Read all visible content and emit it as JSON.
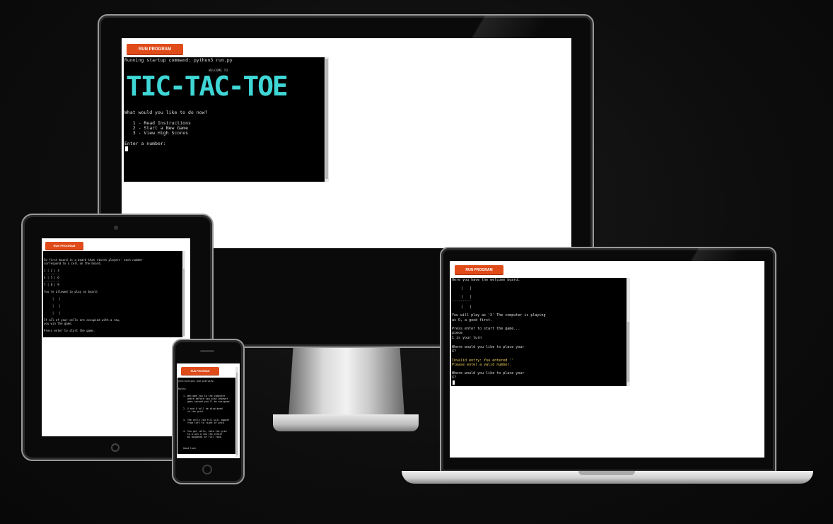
{
  "run_label": "RUN PROGRAM",
  "desktop": {
    "lines": [
      "Running startup command: python3 run.py",
      "What would you like to do now?",
      "   1 - Read Instructions",
      "   2 - Start a New Game",
      "   3 - View High Scores",
      "Enter a number:"
    ],
    "welcome": "WELCOME TO",
    "big_title": "TIC-TAC-TOE",
    "cursor": "|"
  },
  "tablet": {
    "lines": [
      "So first board is a board that stores players' each number",
      "correspond to a cell on the board.",
      "1 | 2 | 3",
      "---------",
      "4 | 5 | 6",
      "---------",
      "7 | 8 | 9",
      "You're allowed to play on board:",
      "  |   |",
      "  |   |",
      "  |   |",
      "If all of your cells are occupied with a row,",
      "you win the game.",
      "Press enter to start the game."
    ]
  },
  "phone": {
    "lines": [
      "Instructions and overview",
      "Rules:",
      "1. Welcome you to the computer",
      "   where before you play whoever",
      "   goes second you'll be assigned",
      "2. X and O will be displayed",
      "   in the grid.",
      "3. The cells you fill will appear",
      "   from left to right of grid",
      "4. You get cells, hold the grid",
      "   to a win a row the center",
      "   by diagonal or full rows.",
      "Good luck"
    ]
  },
  "laptop": {
    "lines": [
      "Here you have the welcome board:",
      "   |   |",
      "   |   |",
      "---------",
      "   |   |",
      "You will play as 'X' The computer is playing",
      "as O, a good first.",
      "Press enter to start the game...",
      "piece",
      "1 is your turn",
      "Where would you like to place your",
      "X?",
      "Invalid entry: You entered ''",
      "Please enter a valid number.",
      "Where would you like to place your",
      "X?"
    ]
  }
}
